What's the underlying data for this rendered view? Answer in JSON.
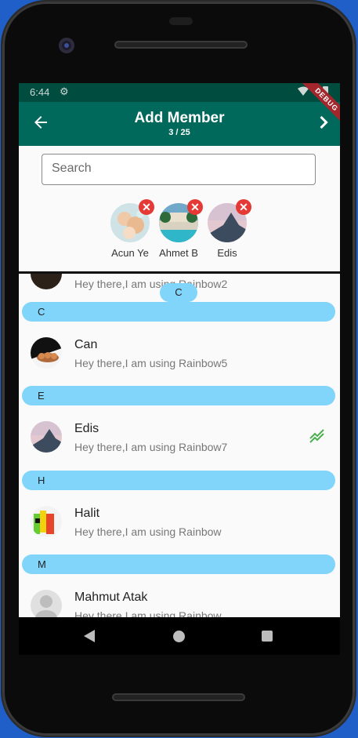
{
  "statusbar": {
    "time": "6:44"
  },
  "appbar": {
    "title": "Add Member",
    "count": "3 / 25",
    "debug": "DEBUG"
  },
  "search": {
    "placeholder": "Search",
    "value": ""
  },
  "selected": [
    {
      "name": "Acun Ye"
    },
    {
      "name": "Ahmet B"
    },
    {
      "name": "Edis"
    }
  ],
  "list": {
    "partial_row": {
      "status": "Hey there,I am using Rainbow2"
    },
    "floating_letter": "C",
    "headers": [
      "C",
      "E",
      "H",
      "M"
    ],
    "rows": [
      {
        "name": "Can",
        "status": "Hey there,I am using Rainbow5"
      },
      {
        "name": "Edis",
        "status": "Hey there,I am using Rainbow7",
        "online": true
      },
      {
        "name": "Halit",
        "status": "Hey there,I am using Rainbow"
      },
      {
        "name": "Mahmut Atak",
        "status": "Hey there,I am using Rainbow"
      }
    ]
  },
  "colors": {
    "appbar": "#00695c",
    "statusbar": "#004d40",
    "header": "#81d4fa",
    "remove": "#e53935",
    "online": "#4caf50"
  }
}
